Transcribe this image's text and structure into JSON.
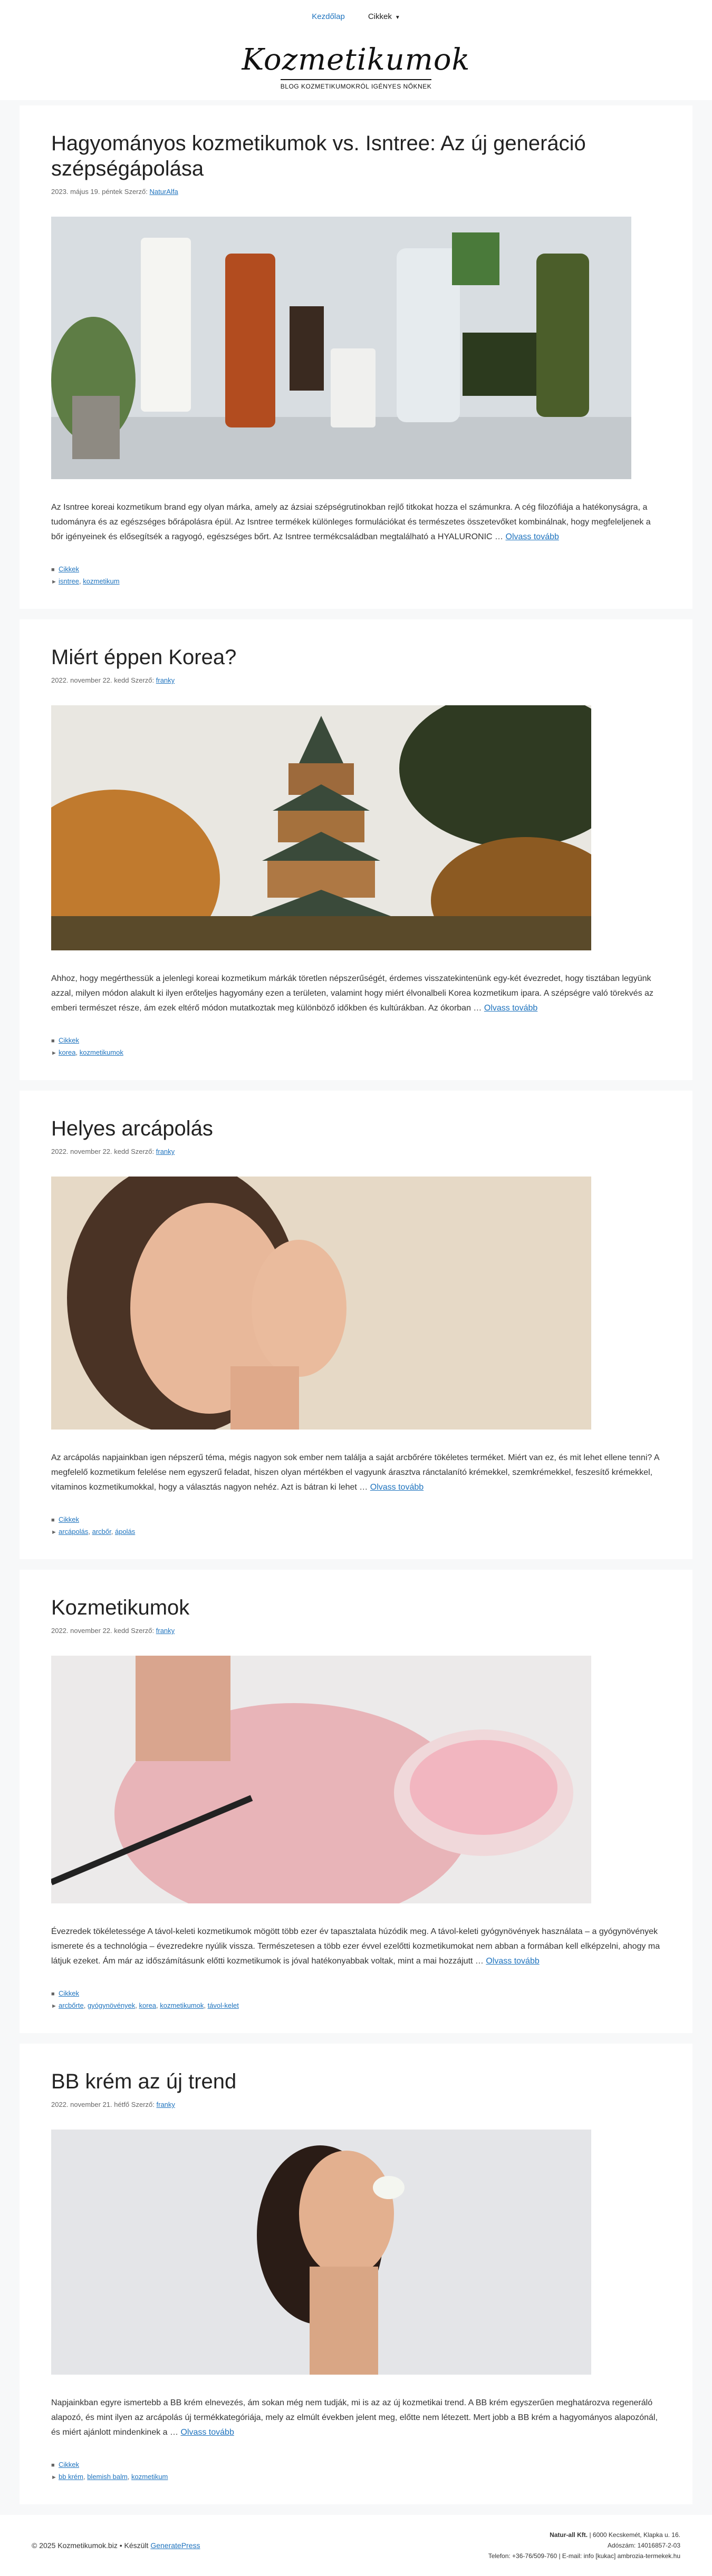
{
  "nav": {
    "home": "Kezdőlap",
    "articles": "Cikkek"
  },
  "site": {
    "logo": "Kozmetikumok",
    "tagline": "BLOG KOZMETIKUMOKRÓL IGÉNYES NŐKNEK"
  },
  "posts": [
    {
      "title": "Hagyományos kozmetikumok vs. Isntree: Az új generáció szépségápolása",
      "date": "2023. május 19. péntek",
      "author_prefix": "Szerző:",
      "author": "NaturAlfa",
      "excerpt": "Az Isntree koreai kozmetikum brand egy olyan márka, amely az ázsiai szépségrutinokban rejlő titkokat hozza el számunkra. A cég filozófiája a hatékonyságra, a tudományra és az egészséges bőrápolásra épül. Az Isntree termékek különleges formulációkat és természetes összetevőket kombinálnak, hogy megfeleljenek a bőr igényeinek és elősegítsék a ragyogó, egészséges bőrt. Az Isntree termékcsaládban megtalálható a HYALURONIC …",
      "more": "Olvass tovább",
      "category": "Cikkek",
      "tags": [
        "isntree",
        "kozmetikum"
      ]
    },
    {
      "title": "Miért éppen Korea?",
      "date": "2022. november 22. kedd",
      "author_prefix": "Szerző:",
      "author": "franky",
      "excerpt": "Ahhoz, hogy megérthessük a jelenlegi koreai kozmetikum márkák töretlen népszerűségét, érdemes visszatekintenünk egy-két évezredet, hogy tisztában legyünk azzal, milyen módon alakult ki ilyen erőteljes hagyomány ezen a területen, valamint hogy miért élvonalbeli Korea kozmetikum ipara. A szépségre való törekvés az emberi természet része, ám ezek eltérő módon mutatkoztak meg különböző időkben és kultúrákban. Az ókorban …",
      "more": "Olvass tovább",
      "category": "Cikkek",
      "tags": [
        "korea",
        "kozmetikumok"
      ]
    },
    {
      "title": "Helyes arcápolás",
      "date": "2022. november 22. kedd",
      "author_prefix": "Szerző:",
      "author": "franky",
      "excerpt": "Az arcápolás napjainkban igen népszerű téma, mégis nagyon sok ember nem találja a saját arcbőrére tökéletes terméket. Miért van ez, és mit lehet ellene tenni? A megfelelő kozmetikum felelése nem egyszerű feladat, hiszen olyan mértékben el vagyunk árasztva ránctalanító krémekkel, szemkrémekkel, feszesítő krémekkel, vitaminos kozmetikumokkal, hogy a választás nagyon nehéz. Azt is bátran ki lehet …",
      "more": "Olvass tovább",
      "category": "Cikkek",
      "tags": [
        "arcápolás",
        "arcbőr",
        "ápolás"
      ]
    },
    {
      "title": "Kozmetikumok",
      "date": "2022. november 22. kedd",
      "author_prefix": "Szerző:",
      "author": "franky",
      "excerpt": "Évezredek tökéletessége A távol-keleti kozmetikumok mögött több ezer év tapasztalata húzódik meg. A távol-keleti gyógynövények használata – a gyógynövények ismerete és a technológia – évezredekre nyúlik vissza. Természetesen a több ezer évvel ezelőtti kozmetikumokat nem abban a formában kell elképzelni, ahogy ma látjuk ezeket. Ám már az időszámításunk előtti kozmetikumok is jóval hatékonyabbak voltak, mint a mai hozzájutt …",
      "more": "Olvass tovább",
      "category": "Cikkek",
      "tags": [
        "arcbőrte",
        "gyógynövények",
        "korea",
        "kozmetikumok",
        "távol-kelet"
      ]
    },
    {
      "title": "BB krém az új trend",
      "date": "2022. november 21. hétfő",
      "author_prefix": "Szerző:",
      "author": "franky",
      "excerpt": "Napjainkban egyre ismertebb a BB krém elnevezés, ám sokan még nem tudják, mi is az az új kozmetikai trend. A BB krém egyszerűen meghatározva regeneráló alapozó, és mint ilyen az arcápolás új termékkategóriája, mely az elmúlt években jelent meg, előtte nem létezett. Mert jobb a BB krém a hagyományos alapozónál, és miért ajánlott mindenkinek a …",
      "more": "Olvass tovább",
      "category": "Cikkek",
      "tags": [
        "bb krém",
        "blemish balm",
        "kozmetikum"
      ]
    }
  ],
  "footer": {
    "copyright": "© 2025 Kozmetikumok.biz • Készült",
    "builder": "GeneratePress",
    "company": "Natur-all Kft.",
    "address": "| 6000 Kecskemét, Klapka u. 16.",
    "tax": "Adószám: 14016857-2-03",
    "contact": "Telefon: +36-76/509-760 | E-mail: info [kukac] ambrozia-termekek.hu"
  },
  "colors": {
    "link": "#1e73be",
    "bg": "#f7f8f9"
  }
}
